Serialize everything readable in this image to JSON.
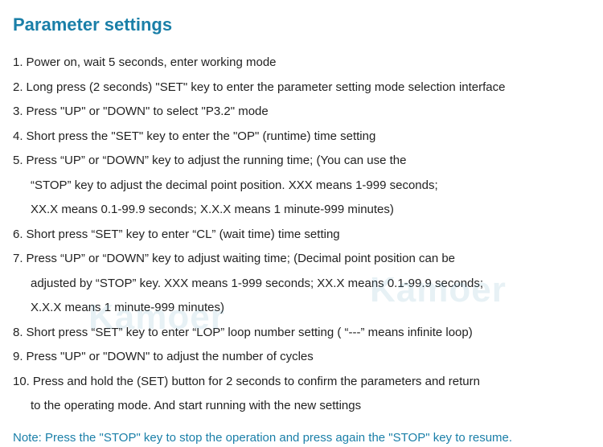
{
  "title": "Parameter settings",
  "steps": [
    {
      "n": "1.",
      "lines": [
        "Power on, wait 5 seconds, enter working mode"
      ]
    },
    {
      "n": "2.",
      "lines": [
        "Long press (2 seconds) \"SET\" key to enter the parameter setting mode selection interface"
      ]
    },
    {
      "n": "3.",
      "lines": [
        "Press \"UP\" or \"DOWN\" to select \"P3.2\" mode"
      ]
    },
    {
      "n": "4.",
      "lines": [
        "Short press the \"SET\" key to enter the \"OP\" (runtime) time setting"
      ]
    },
    {
      "n": "5.",
      "lines": [
        "Press “UP” or “DOWN” key to adjust the running time; (You can use the",
        "“STOP” key to adjust the decimal point position. XXX means 1-999 seconds;",
        "XX.X means 0.1-99.9 seconds; X.X.X means 1 minute-999 minutes)"
      ]
    },
    {
      "n": "6.",
      "lines": [
        "Short press “SET” key to enter “CL” (wait time) time setting"
      ]
    },
    {
      "n": "7.",
      "lines": [
        "Press “UP” or “DOWN” key to adjust waiting time; (Decimal point position can be",
        "adjusted by “STOP” key. XXX means 1-999 seconds; XX.X means 0.1-99.9 seconds;",
        "X.X.X means 1 minute-999 minutes)"
      ]
    },
    {
      "n": "8.",
      "lines": [
        "Short press “SET” key to enter “LOP” loop number setting ( “---” means infinite loop)"
      ]
    },
    {
      "n": "9.",
      "lines": [
        "Press \"UP\" or \"DOWN\" to adjust the number of cycles"
      ]
    },
    {
      "n": "10.",
      "lines": [
        "Press and hold the (SET) button for 2 seconds to confirm the parameters and return",
        "to the operating mode. And start running with the new settings"
      ]
    }
  ],
  "note": "Note: Press the \"STOP\" key to stop the operation and press again the \"STOP\" key to resume.",
  "watermark": "Kamoer"
}
